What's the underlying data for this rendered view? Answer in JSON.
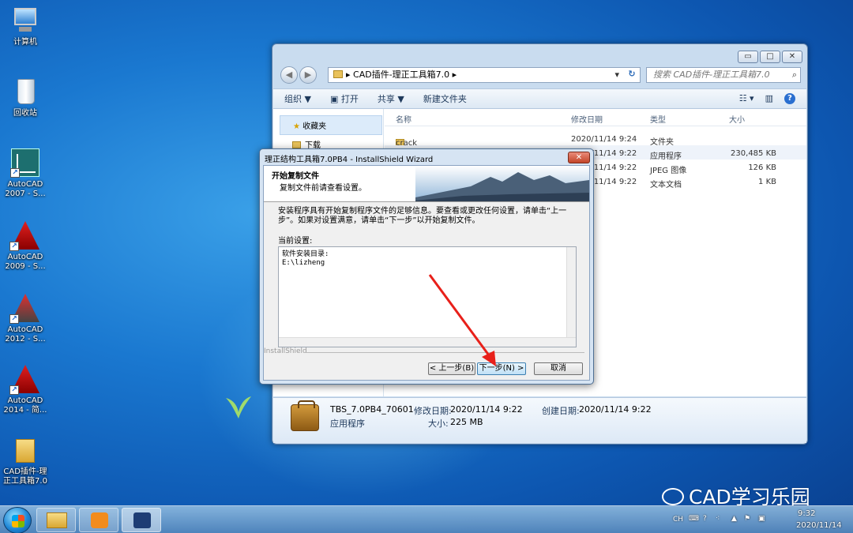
{
  "desktop_icons": [
    {
      "label": "计算机",
      "icon": "computer-icon"
    },
    {
      "label": "回收站",
      "icon": "recycle-bin-icon"
    },
    {
      "label": "AutoCAD\n2007 - S...",
      "icon": "autocad-2007-icon"
    },
    {
      "label": "AutoCAD\n2009 - S...",
      "icon": "autocad-2009-icon"
    },
    {
      "label": "AutoCAD\n2012 - S...",
      "icon": "autocad-2012-icon"
    },
    {
      "label": "AutoCAD\n2014 - 简...",
      "icon": "autocad-2014-icon"
    },
    {
      "label": "CAD插件-理\n正工具箱7.0",
      "icon": "folder-icon"
    }
  ],
  "explorer": {
    "address": "CAD插件-理正工具箱7.0",
    "search_placeholder": "搜索 CAD插件-理正工具箱7.0",
    "toolbar": {
      "organize": "组织 ▼",
      "open": "打开",
      "share": "共享 ▼",
      "new_folder": "新建文件夹"
    },
    "nav": {
      "favorites": "收藏夹",
      "downloads": "下载"
    },
    "columns": {
      "name": "名称",
      "date": "修改日期",
      "type": "类型",
      "size": "大小"
    },
    "files": [
      {
        "name": "crack",
        "date": "2020/11/14 9:24",
        "type": "文件夹",
        "size": ""
      },
      {
        "name": "",
        "date": "2020/11/14 9:22",
        "type": "应用程序",
        "size": "230,485 KB"
      },
      {
        "name": "",
        "date": "2020/11/14 9:22",
        "type": "JPEG 图像",
        "size": "126 KB"
      },
      {
        "name": "",
        "date": "2020/11/14 9:22",
        "type": "文本文档",
        "size": "1 KB"
      }
    ],
    "details": {
      "filename": "TBS_7.0PB4_70601",
      "modified_label": "修改日期:",
      "modified": "2020/11/14 9:22",
      "created_label": "创建日期:",
      "created": "2020/11/14 9:22",
      "type": "应用程序",
      "size_label": "大小:",
      "size": "225 MB"
    }
  },
  "dialog": {
    "title": "理正结构工具箱7.0PB4 - InstallShield Wizard",
    "heading": "开始复制文件",
    "subheading": "复制文件前请查看设置。",
    "intro": "安装程序具有开始复制程序文件的足够信息。要查看或更改任何设置，请单击“上一步”。如果对设置满意，请单击“下一步”以开始复制文件。",
    "current_settings_label": "当前设置:",
    "settings_line1": "软件安装目录:",
    "settings_line2": "E:\\lizheng",
    "brand": "InstallShield",
    "back_button": "< 上一步(B)",
    "next_button": "下一步(N) >",
    "cancel_button": "取消"
  },
  "taskbar": {
    "lang": "CH",
    "time": "9:32",
    "date": "2020/11/14"
  },
  "watermark": "CAD学习乐园",
  "colors": {
    "annotation_arrow": "#e8201a",
    "desktop": "#1a78d0"
  }
}
